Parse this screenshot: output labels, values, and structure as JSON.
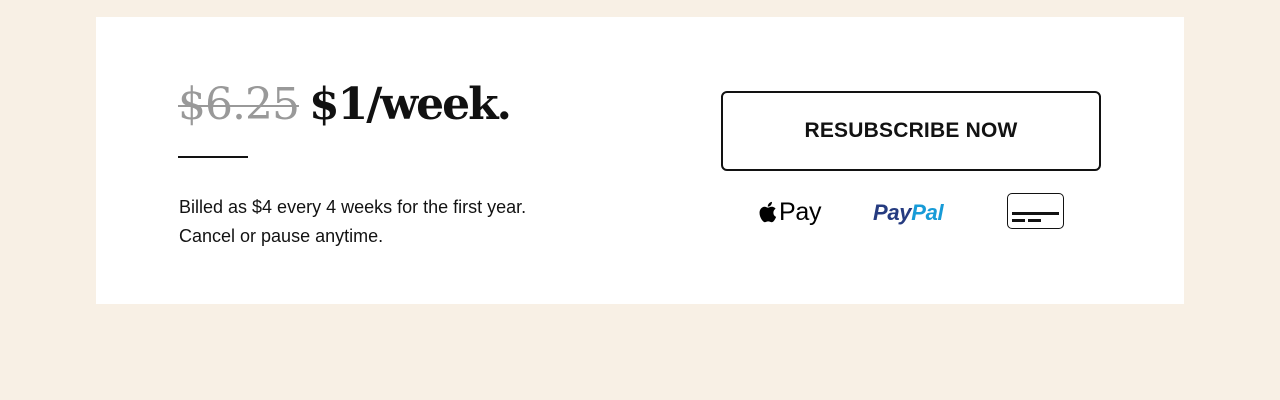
{
  "offer": {
    "old_price": "$6.25",
    "new_price": "$1/week.",
    "billing_line_1": "Billed as $4 every 4 weeks for the first year.",
    "billing_line_2": "Cancel or pause anytime."
  },
  "cta": {
    "label": "RESUBSCRIBE NOW"
  },
  "payment_methods": {
    "apple_pay_label": "Pay",
    "paypal_part_1": "Pay",
    "paypal_part_2": "Pal",
    "icons": [
      "apple-logo-icon",
      "paypal-logo-icon",
      "credit-card-icon"
    ]
  },
  "colors": {
    "page_background": "#f8f0e5",
    "card_background": "#ffffff",
    "old_price": "#999999",
    "text": "#121212",
    "paypal_dark": "#253b80",
    "paypal_light": "#179bd7"
  }
}
